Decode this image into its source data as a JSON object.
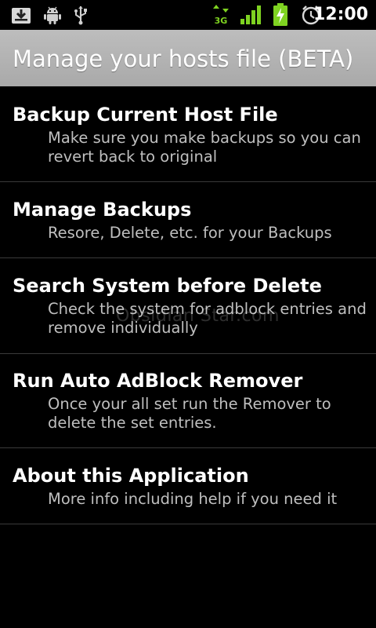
{
  "status_bar": {
    "icons": [
      "download-icon",
      "android-icon",
      "usb-icon",
      "data-3g-icon",
      "signal-icon",
      "battery-charging-icon",
      "alarm-clock-icon"
    ],
    "clock": "12:00",
    "network_label": "3G"
  },
  "title_bar": {
    "title": "Manage your hosts file (BETA)"
  },
  "menu": {
    "items": [
      {
        "title": "Backup Current Host File",
        "description": "Make sure you make backups so you can revert back to original"
      },
      {
        "title": "Manage Backups",
        "description": "Resore, Delete, etc. for your Backups"
      },
      {
        "title": "Search System before Delete",
        "description": "Check the system for adblock entries and remove individually"
      },
      {
        "title": "Run Auto AdBlock Remover",
        "description": "Once your all set run the Remover to delete the set entries."
      },
      {
        "title": "About this Application",
        "description": "More info including help if you need it"
      }
    ]
  },
  "watermark": "Obsidian Star.com",
  "colors": {
    "background": "#000000",
    "title_bar": "#b3b3b3",
    "description_text": "#bfbfbf",
    "divider": "#3a3a3a",
    "status_green": "#7fd321"
  }
}
